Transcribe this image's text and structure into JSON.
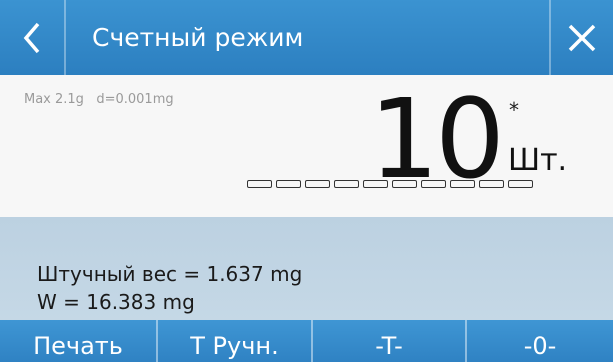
{
  "header": {
    "title": "Счетный режим",
    "back_icon": "chevron-left-icon",
    "close_icon": "close-icon"
  },
  "display": {
    "max": "Max 2.1g",
    "d": "d=0.001mg",
    "count": "10",
    "star": "*",
    "unit": "Шт.",
    "segments": 10
  },
  "info": {
    "piece_weight": "Штучный вес = 1.637 mg",
    "weight": "W = 16.383 mg"
  },
  "footer": {
    "buttons": [
      "Печать",
      "Т Ручн.",
      "-T-",
      "-0-"
    ]
  },
  "colors": {
    "bar_blue": "#2f82c3",
    "info_bg": "#c5d8e6",
    "display_bg": "#f7f7f7"
  }
}
